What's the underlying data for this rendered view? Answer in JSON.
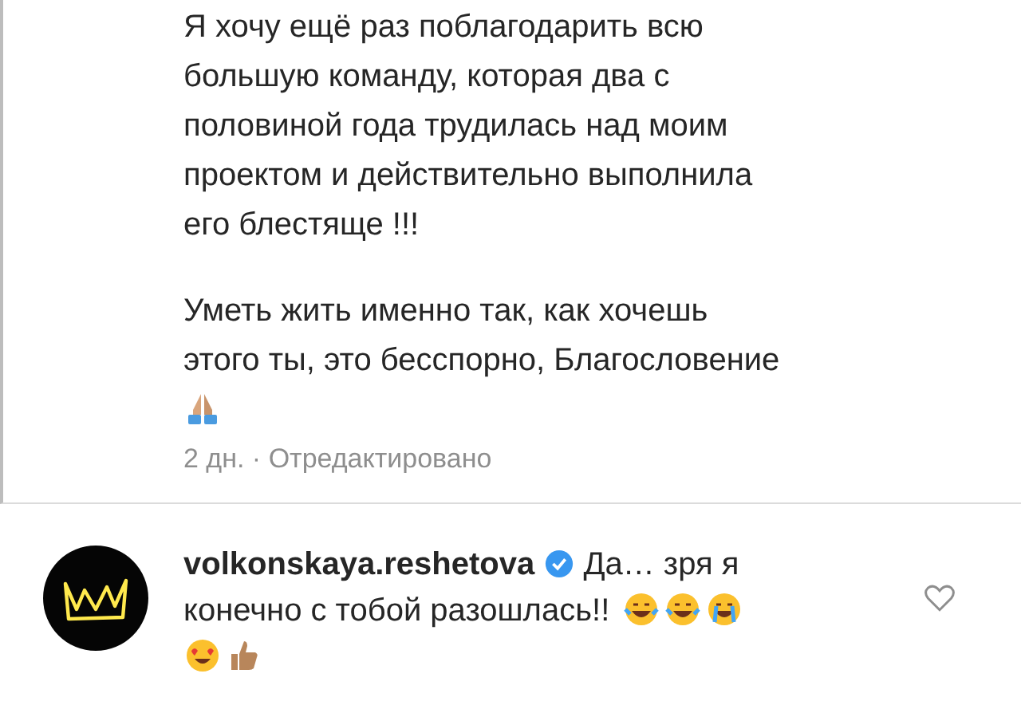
{
  "comments": [
    {
      "kind": "text",
      "paragraphs": [
        "Я хочу ещё раз поблагодарить всю\nбольшую команду, которая два с\nполовиной года трудилась над моим\nпроектом и действительно выполнила\nего блестяще !!!",
        "Уметь жить именно так, как хочешь\nэтого ты, это бесспорно, Благословение"
      ],
      "meta": "2 дн. · Отредактировано"
    },
    {
      "kind": "reply",
      "username": "volkonskaya.reshetova",
      "verified": true,
      "text_lines": [
        "Да… зря я",
        "конечно с тобой разошлась!!"
      ],
      "liked": false
    }
  ]
}
